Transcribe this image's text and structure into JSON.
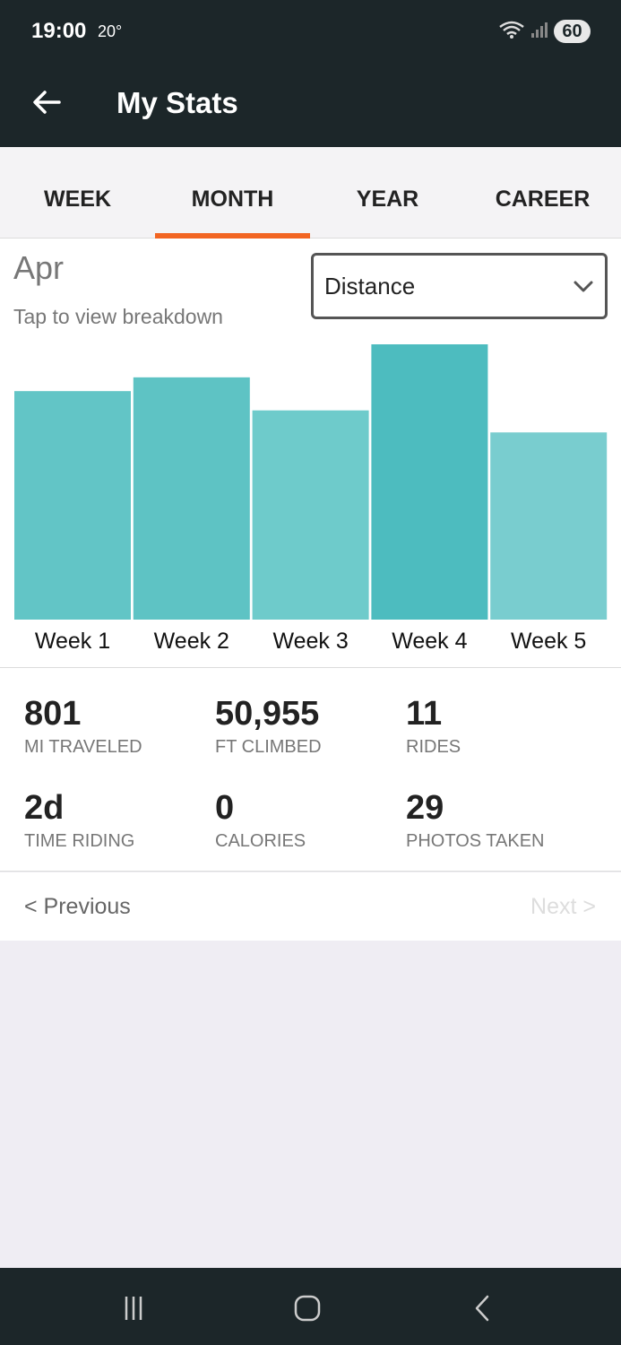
{
  "status_bar": {
    "time": "19:00",
    "temperature": "20°",
    "battery": "60"
  },
  "app_bar": {
    "title": "My Stats"
  },
  "tabs": [
    {
      "label": "WEEK",
      "active": false
    },
    {
      "label": "MONTH",
      "active": true
    },
    {
      "label": "YEAR",
      "active": false
    },
    {
      "label": "CAREER",
      "active": false
    }
  ],
  "chart_header": {
    "period": "Apr",
    "hint": "Tap to view breakdown",
    "metric_selected": "Distance"
  },
  "chart_data": {
    "type": "bar",
    "categories": [
      "Week 1",
      "Week 2",
      "Week 3",
      "Week 4",
      "Week 5"
    ],
    "values": [
      0.83,
      0.88,
      0.76,
      1.0,
      0.68
    ],
    "colors": [
      "#62c5c6",
      "#5ec3c4",
      "#6ecbcb",
      "#4dbcbf",
      "#79cdcf"
    ],
    "ylim": [
      0,
      1
    ]
  },
  "stats": [
    {
      "value": "801",
      "label": "MI TRAVELED"
    },
    {
      "value": "50,955",
      "label": "FT CLIMBED"
    },
    {
      "value": "11",
      "label": "RIDES"
    },
    {
      "value": "2d",
      "label": "TIME RIDING"
    },
    {
      "value": "0",
      "label": "CALORIES"
    },
    {
      "value": "29",
      "label": "PHOTOS TAKEN"
    }
  ],
  "pager": {
    "previous": "< Previous",
    "next": "Next >"
  },
  "accent_color": "#f26522"
}
